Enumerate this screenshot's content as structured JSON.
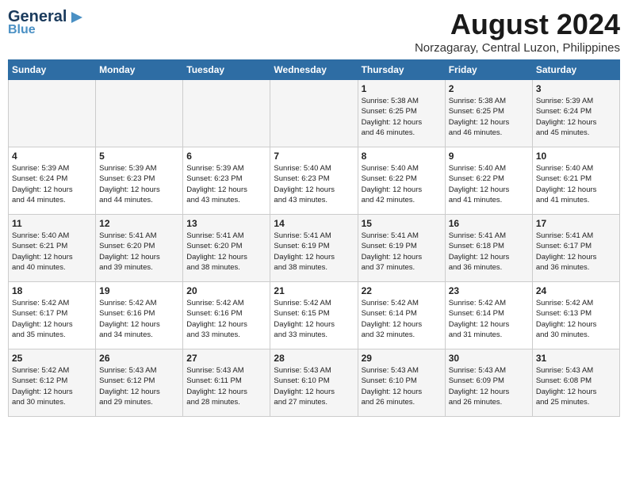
{
  "header": {
    "logo_general": "General",
    "logo_blue": "Blue",
    "month": "August 2024",
    "location": "Norzagaray, Central Luzon, Philippines"
  },
  "weekdays": [
    "Sunday",
    "Monday",
    "Tuesday",
    "Wednesday",
    "Thursday",
    "Friday",
    "Saturday"
  ],
  "weeks": [
    [
      {
        "day": "",
        "info": ""
      },
      {
        "day": "",
        "info": ""
      },
      {
        "day": "",
        "info": ""
      },
      {
        "day": "",
        "info": ""
      },
      {
        "day": "1",
        "info": "Sunrise: 5:38 AM\nSunset: 6:25 PM\nDaylight: 12 hours\nand 46 minutes."
      },
      {
        "day": "2",
        "info": "Sunrise: 5:38 AM\nSunset: 6:25 PM\nDaylight: 12 hours\nand 46 minutes."
      },
      {
        "day": "3",
        "info": "Sunrise: 5:39 AM\nSunset: 6:24 PM\nDaylight: 12 hours\nand 45 minutes."
      }
    ],
    [
      {
        "day": "4",
        "info": "Sunrise: 5:39 AM\nSunset: 6:24 PM\nDaylight: 12 hours\nand 44 minutes."
      },
      {
        "day": "5",
        "info": "Sunrise: 5:39 AM\nSunset: 6:23 PM\nDaylight: 12 hours\nand 44 minutes."
      },
      {
        "day": "6",
        "info": "Sunrise: 5:39 AM\nSunset: 6:23 PM\nDaylight: 12 hours\nand 43 minutes."
      },
      {
        "day": "7",
        "info": "Sunrise: 5:40 AM\nSunset: 6:23 PM\nDaylight: 12 hours\nand 43 minutes."
      },
      {
        "day": "8",
        "info": "Sunrise: 5:40 AM\nSunset: 6:22 PM\nDaylight: 12 hours\nand 42 minutes."
      },
      {
        "day": "9",
        "info": "Sunrise: 5:40 AM\nSunset: 6:22 PM\nDaylight: 12 hours\nand 41 minutes."
      },
      {
        "day": "10",
        "info": "Sunrise: 5:40 AM\nSunset: 6:21 PM\nDaylight: 12 hours\nand 41 minutes."
      }
    ],
    [
      {
        "day": "11",
        "info": "Sunrise: 5:40 AM\nSunset: 6:21 PM\nDaylight: 12 hours\nand 40 minutes."
      },
      {
        "day": "12",
        "info": "Sunrise: 5:41 AM\nSunset: 6:20 PM\nDaylight: 12 hours\nand 39 minutes."
      },
      {
        "day": "13",
        "info": "Sunrise: 5:41 AM\nSunset: 6:20 PM\nDaylight: 12 hours\nand 38 minutes."
      },
      {
        "day": "14",
        "info": "Sunrise: 5:41 AM\nSunset: 6:19 PM\nDaylight: 12 hours\nand 38 minutes."
      },
      {
        "day": "15",
        "info": "Sunrise: 5:41 AM\nSunset: 6:19 PM\nDaylight: 12 hours\nand 37 minutes."
      },
      {
        "day": "16",
        "info": "Sunrise: 5:41 AM\nSunset: 6:18 PM\nDaylight: 12 hours\nand 36 minutes."
      },
      {
        "day": "17",
        "info": "Sunrise: 5:41 AM\nSunset: 6:17 PM\nDaylight: 12 hours\nand 36 minutes."
      }
    ],
    [
      {
        "day": "18",
        "info": "Sunrise: 5:42 AM\nSunset: 6:17 PM\nDaylight: 12 hours\nand 35 minutes."
      },
      {
        "day": "19",
        "info": "Sunrise: 5:42 AM\nSunset: 6:16 PM\nDaylight: 12 hours\nand 34 minutes."
      },
      {
        "day": "20",
        "info": "Sunrise: 5:42 AM\nSunset: 6:16 PM\nDaylight: 12 hours\nand 33 minutes."
      },
      {
        "day": "21",
        "info": "Sunrise: 5:42 AM\nSunset: 6:15 PM\nDaylight: 12 hours\nand 33 minutes."
      },
      {
        "day": "22",
        "info": "Sunrise: 5:42 AM\nSunset: 6:14 PM\nDaylight: 12 hours\nand 32 minutes."
      },
      {
        "day": "23",
        "info": "Sunrise: 5:42 AM\nSunset: 6:14 PM\nDaylight: 12 hours\nand 31 minutes."
      },
      {
        "day": "24",
        "info": "Sunrise: 5:42 AM\nSunset: 6:13 PM\nDaylight: 12 hours\nand 30 minutes."
      }
    ],
    [
      {
        "day": "25",
        "info": "Sunrise: 5:42 AM\nSunset: 6:12 PM\nDaylight: 12 hours\nand 30 minutes."
      },
      {
        "day": "26",
        "info": "Sunrise: 5:43 AM\nSunset: 6:12 PM\nDaylight: 12 hours\nand 29 minutes."
      },
      {
        "day": "27",
        "info": "Sunrise: 5:43 AM\nSunset: 6:11 PM\nDaylight: 12 hours\nand 28 minutes."
      },
      {
        "day": "28",
        "info": "Sunrise: 5:43 AM\nSunset: 6:10 PM\nDaylight: 12 hours\nand 27 minutes."
      },
      {
        "day": "29",
        "info": "Sunrise: 5:43 AM\nSunset: 6:10 PM\nDaylight: 12 hours\nand 26 minutes."
      },
      {
        "day": "30",
        "info": "Sunrise: 5:43 AM\nSunset: 6:09 PM\nDaylight: 12 hours\nand 26 minutes."
      },
      {
        "day": "31",
        "info": "Sunrise: 5:43 AM\nSunset: 6:08 PM\nDaylight: 12 hours\nand 25 minutes."
      }
    ]
  ]
}
